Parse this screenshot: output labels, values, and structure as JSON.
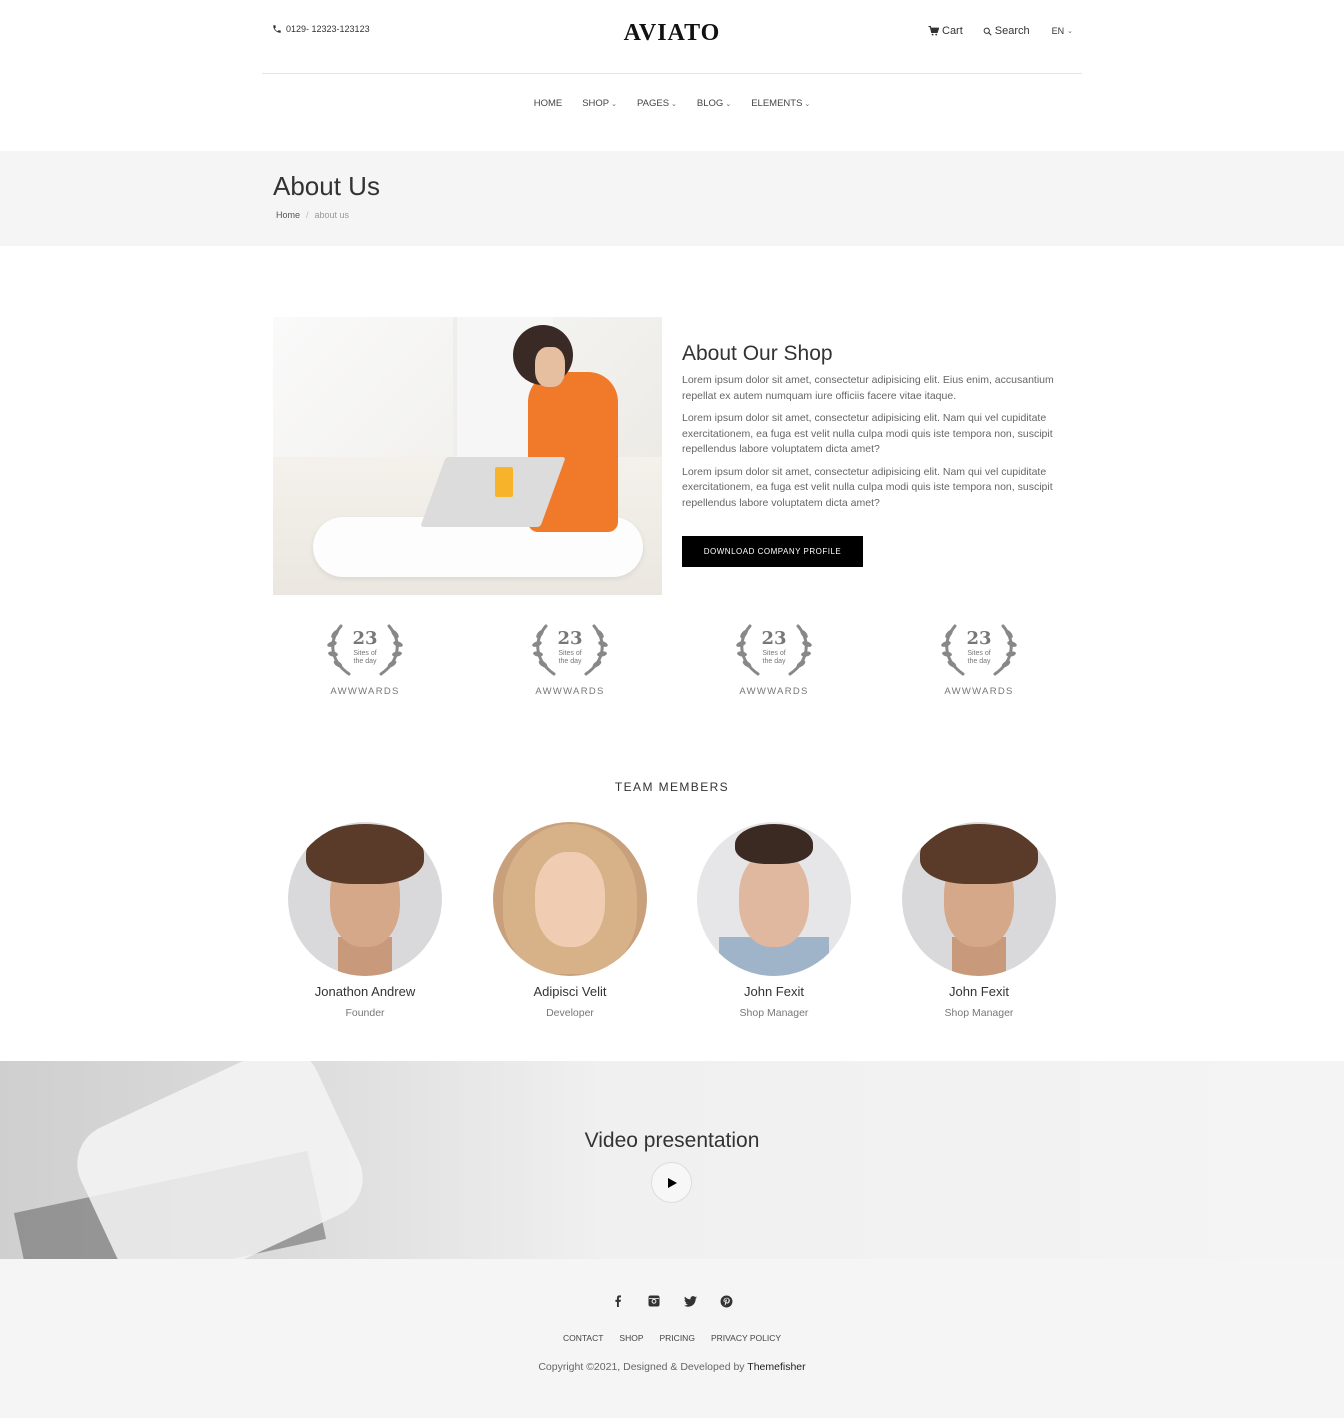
{
  "header": {
    "phone": "0129- 12323-123123",
    "logo": "AVIATO",
    "cart_label": "Cart",
    "search_label": "Search",
    "language": "EN"
  },
  "nav": {
    "items": [
      {
        "label": "HOME"
      },
      {
        "label": "SHOP"
      },
      {
        "label": "PAGES"
      },
      {
        "label": "BLOG"
      },
      {
        "label": "ELEMENTS"
      }
    ]
  },
  "page_header": {
    "title": "About Us",
    "breadcrumb_home": "Home",
    "breadcrumb_current": "about us"
  },
  "about": {
    "title": "About Our Shop",
    "paragraphs": [
      "Lorem ipsum dolor sit amet, consectetur adipisicing elit. Eius enim, accusantium repellat ex autem numquam iure officiis facere vitae itaque.",
      "Lorem ipsum dolor sit amet, consectetur adipisicing elit. Nam qui vel cupiditate exercitationem, ea fuga est velit nulla culpa modi quis iste tempora non, suscipit repellendus labore voluptatem dicta amet?",
      "Lorem ipsum dolor sit amet, consectetur adipisicing elit. Nam qui vel cupiditate exercitationem, ea fuga est velit nulla culpa modi quis iste tempora non, suscipit repellendus labore voluptatem dicta amet?"
    ],
    "button_label": "DOWNLOAD COMPANY PROFILE"
  },
  "awards": [
    {
      "number": "23",
      "line1": "Sites of",
      "line2": "the day",
      "label": "AWWWARDS"
    },
    {
      "number": "23",
      "line1": "Sites of",
      "line2": "the day",
      "label": "AWWWARDS"
    },
    {
      "number": "23",
      "line1": "Sites of",
      "line2": "the day",
      "label": "AWWWARDS"
    },
    {
      "number": "23",
      "line1": "Sites of",
      "line2": "the day",
      "label": "AWWWARDS"
    }
  ],
  "team": {
    "heading": "TEAM MEMBERS",
    "members": [
      {
        "name": "Jonathon Andrew",
        "role": "Founder"
      },
      {
        "name": "Adipisci Velit",
        "role": "Developer"
      },
      {
        "name": "John Fexit",
        "role": "Shop Manager"
      },
      {
        "name": "John Fexit",
        "role": "Shop Manager"
      }
    ]
  },
  "video": {
    "title": "Video presentation"
  },
  "footer": {
    "socials": [
      "facebook-icon",
      "instagram-icon",
      "twitter-icon",
      "pinterest-icon"
    ],
    "links": [
      "CONTACT",
      "SHOP",
      "PRICING",
      "PRIVACY POLICY"
    ],
    "copyright_prefix": "Copyright ©2021, Designed & Developed by ",
    "copyright_brand": "Themefisher"
  }
}
